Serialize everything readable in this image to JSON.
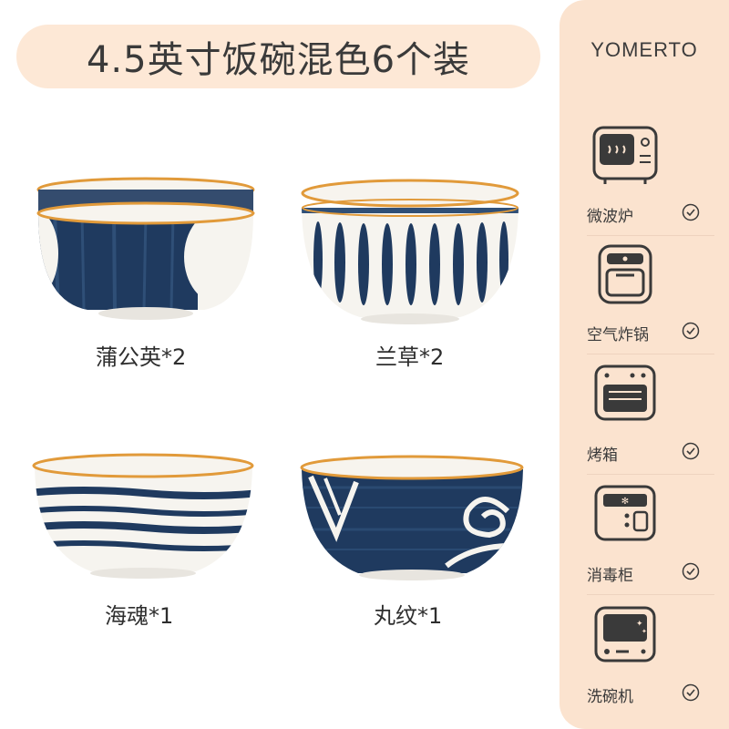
{
  "title": "4.5英寸饭碗混色6个装",
  "brand": "YOMERTO",
  "bowls": [
    {
      "caption": "蒲公英*2"
    },
    {
      "caption": "兰草*2"
    },
    {
      "caption": "海魂*1"
    },
    {
      "caption": "丸纹*1"
    }
  ],
  "features": [
    {
      "label": "微波炉",
      "icon": "microwave-icon"
    },
    {
      "label": "空气炸锅",
      "icon": "air-fryer-icon"
    },
    {
      "label": "烤箱",
      "icon": "oven-icon"
    },
    {
      "label": "消毒柜",
      "icon": "sterilizer-icon"
    },
    {
      "label": "洗碗机",
      "icon": "dishwasher-icon"
    }
  ],
  "colors": {
    "accent": "#fbe3cf",
    "navy": "#1f3a5f",
    "rim": "#e19a3a",
    "text": "#3a3a3a"
  }
}
